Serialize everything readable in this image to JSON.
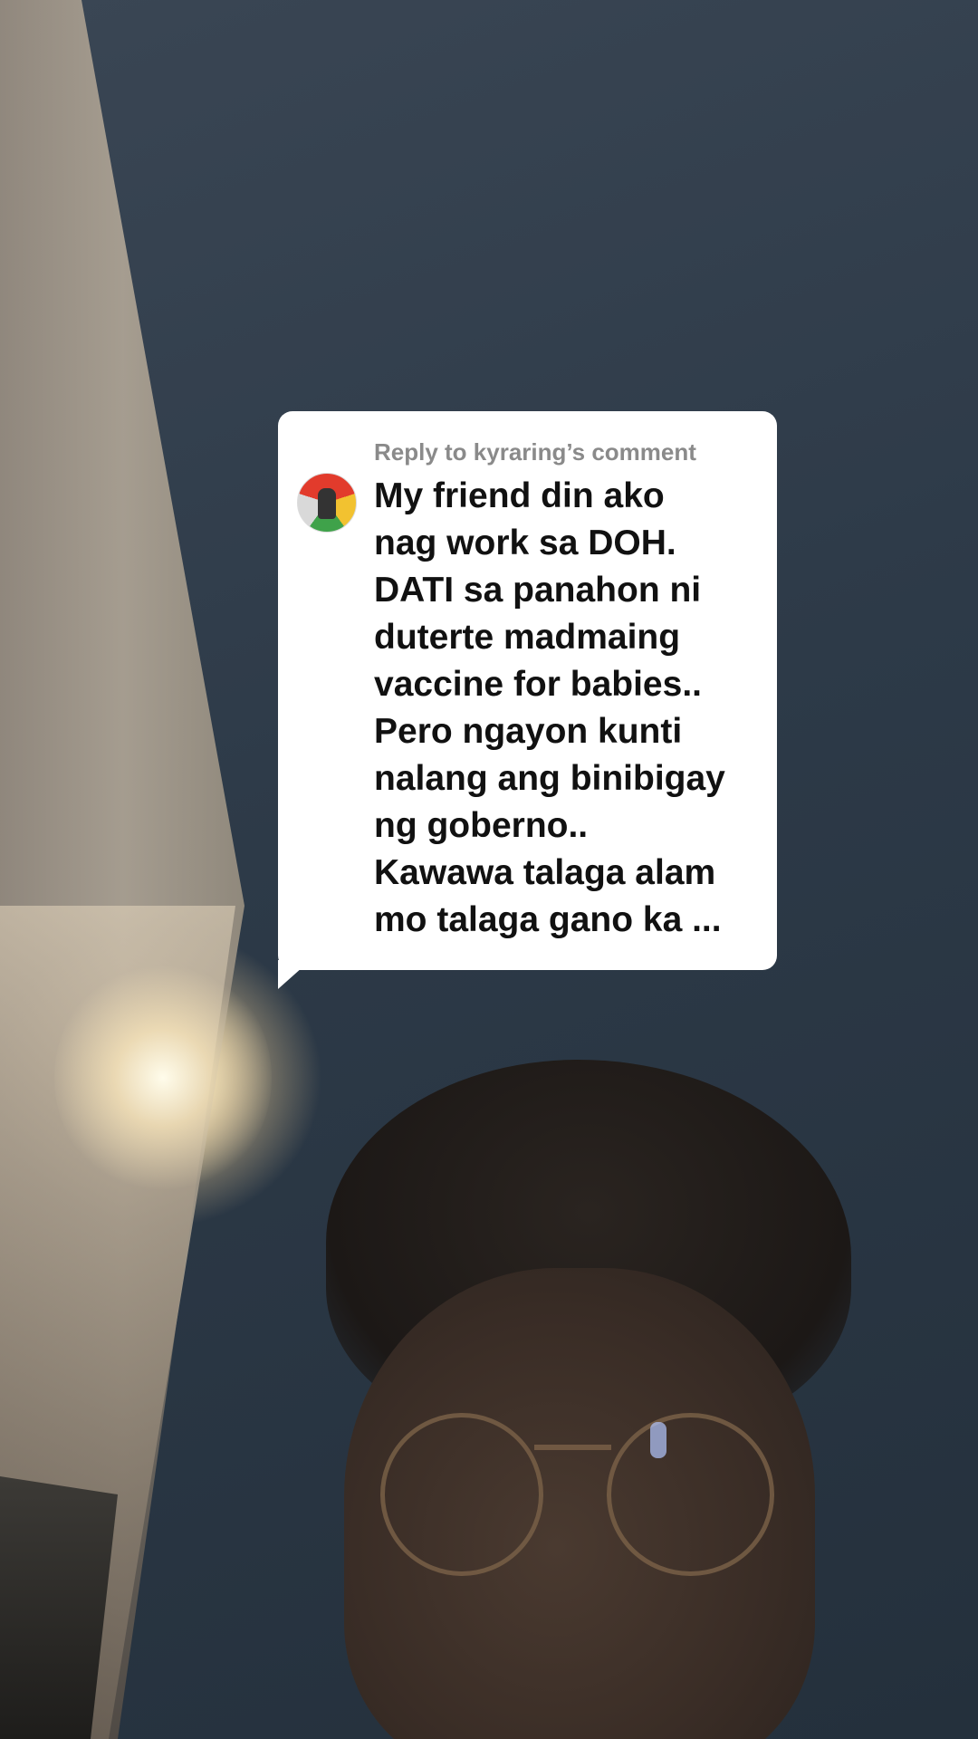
{
  "comment_card": {
    "reply_header": "Reply to kyraring’s comment",
    "avatar_icon": "user-avatar",
    "lines": [
      "My friend din ako",
      "nag work sa DOH.",
      "DATI sa panahon ni",
      "duterte madmaing",
      "vaccine for babies..",
      "Pero ngayon kunti",
      "nalang ang binibigay",
      "ng goberno..",
      "Kawawa talaga alam",
      "mo talaga gano ka ..."
    ]
  },
  "colors": {
    "bubble_background": "#ffffff",
    "header_text": "#8a8a8a",
    "comment_text": "#111111"
  }
}
